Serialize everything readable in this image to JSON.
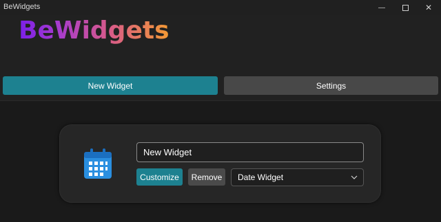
{
  "window": {
    "title": "BeWidgets",
    "minimize_glyph": "—",
    "close_glyph": "✕"
  },
  "header": {
    "logo": "BeWidgets",
    "tabs": [
      {
        "label": "New Widget",
        "active": true
      },
      {
        "label": "Settings",
        "active": false
      }
    ]
  },
  "widget": {
    "icon": "calendar-icon",
    "name_value": "New Widget",
    "customize_label": "Customize",
    "remove_label": "Remove",
    "type_selected": "Date Widget"
  },
  "colors": {
    "accent": "#1d8190",
    "logo_gradient": [
      "#7b1fe8",
      "#d85a8a",
      "#f39a33"
    ],
    "calendar_blue": "#2a8fe0"
  }
}
